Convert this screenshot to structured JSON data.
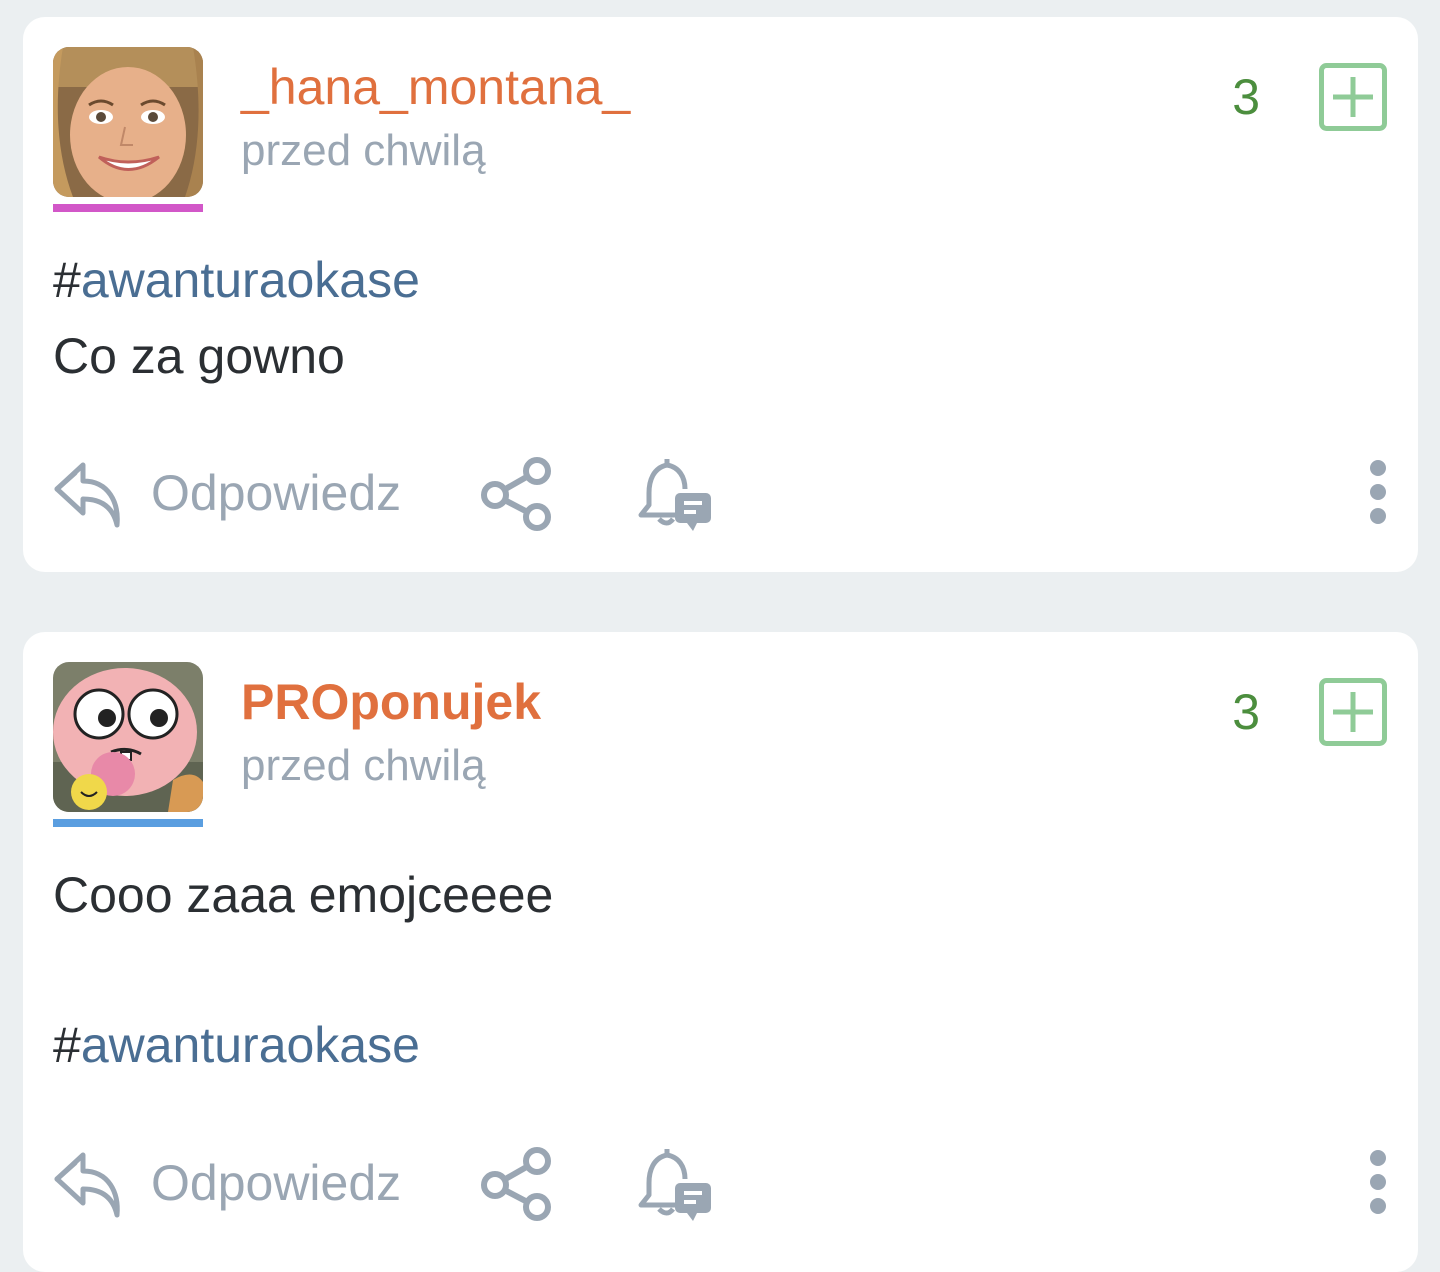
{
  "posts": [
    {
      "username": "_hana_montana_",
      "timestamp": "przed chwilą",
      "votes": "3",
      "avatar_bar_color": "#d257c8",
      "lines": [
        {
          "type": "tag",
          "hash": "#",
          "tag": "awanturaokase"
        },
        {
          "type": "text",
          "text": "Co za gowno"
        }
      ],
      "actions": {
        "reply_label": "Odpowiedz"
      }
    },
    {
      "username": "PROponujek",
      "timestamp": "przed chwilą",
      "votes": "3",
      "avatar_bar_color": "#5a9ee0",
      "lines": [
        {
          "type": "text",
          "text": "Cooo zaaa emojceeee"
        },
        {
          "type": "tag",
          "hash": "#",
          "tag": "awanturaokase"
        }
      ],
      "actions": {
        "reply_label": "Odpowiedz"
      }
    }
  ],
  "colors": {
    "username": "#e0703e",
    "timestamp": "#9aa6b3",
    "vote_count": "#4c8e3e",
    "plus_button": "#8fcb97",
    "tag": "#4a6e93",
    "icon_gray": "#9aa6b3",
    "background": "#ebeff1"
  },
  "icons": {
    "plus": "plus-square-icon",
    "reply": "reply-arrow-icon",
    "share": "share-icon",
    "bell": "bell-notification-icon",
    "more": "more-vertical-icon"
  }
}
